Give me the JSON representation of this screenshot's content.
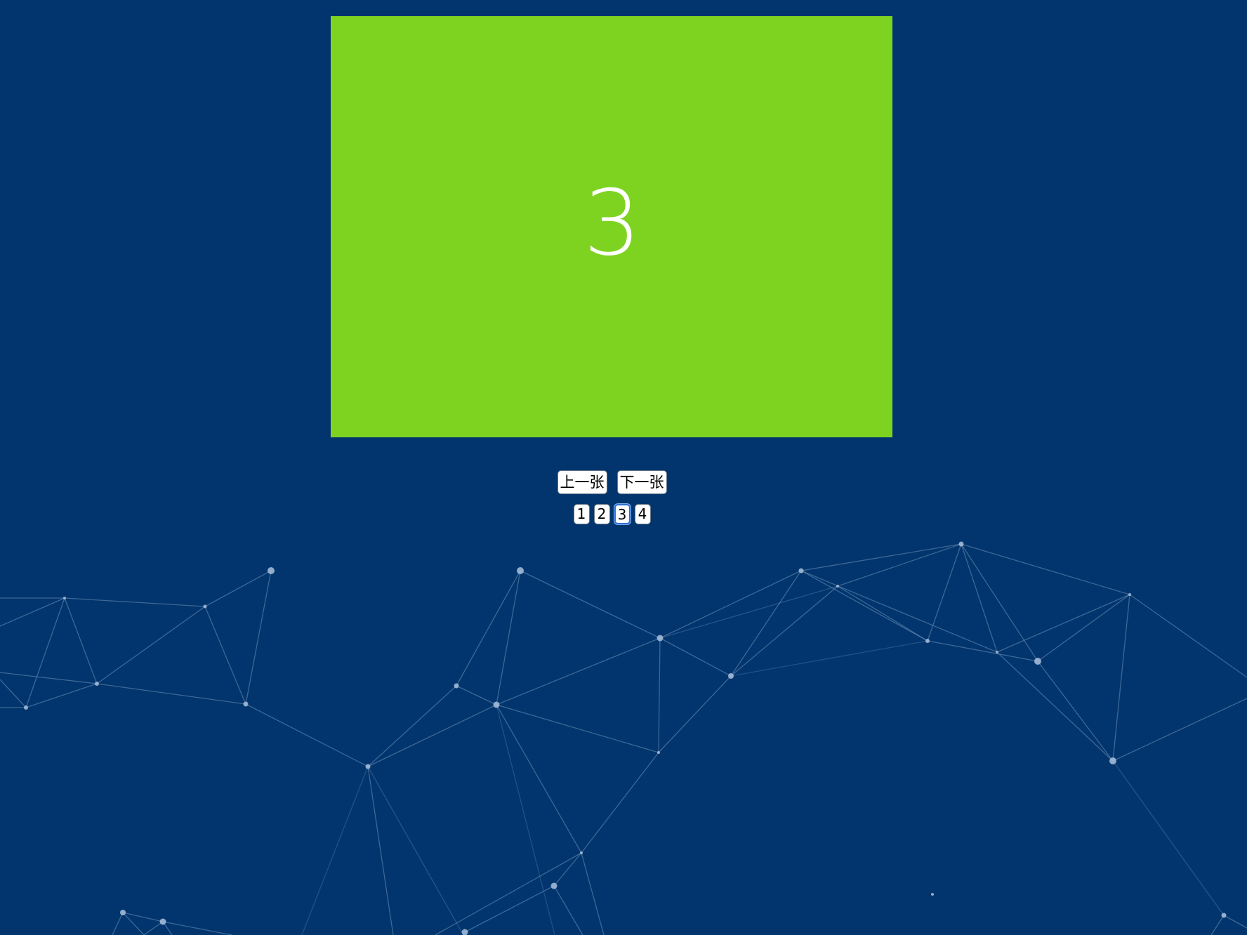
{
  "slider": {
    "current_slide_label": "3",
    "slide_color": "#7ed321",
    "prev_label": "上一张",
    "next_label": "下一张",
    "pages": [
      "1",
      "2",
      "3",
      "4"
    ],
    "active_page": "3"
  },
  "background": {
    "color": "#02356d",
    "decoration": "particle-network"
  }
}
